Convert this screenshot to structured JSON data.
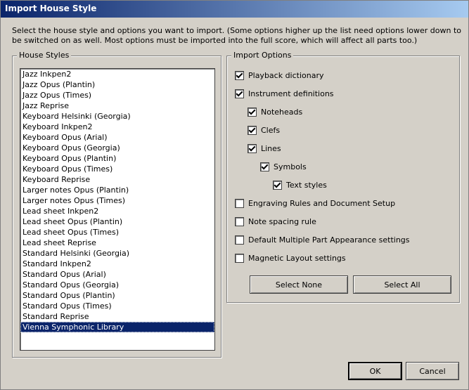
{
  "window": {
    "title": "Import House Style"
  },
  "description": "Select the house style and options you want to import. (Some options higher up the list need options lower down to be switched on as well. Most options must be imported into the full score, which will affect all parts too.)",
  "house_styles": {
    "legend": "House Styles",
    "items": [
      "Jazz Inkpen2",
      "Jazz Opus (Plantin)",
      "Jazz Opus (Times)",
      "Jazz Reprise",
      "Keyboard Helsinki (Georgia)",
      "Keyboard Inkpen2",
      "Keyboard Opus (Arial)",
      "Keyboard Opus (Georgia)",
      "Keyboard Opus (Plantin)",
      "Keyboard Opus (Times)",
      "Keyboard Reprise",
      "Larger notes Opus (Plantin)",
      "Larger notes Opus (Times)",
      "Lead sheet Inkpen2",
      "Lead sheet Opus (Plantin)",
      "Lead sheet Opus (Times)",
      "Lead sheet Reprise",
      "Standard Helsinki (Georgia)",
      "Standard Inkpen2",
      "Standard Opus (Arial)",
      "Standard Opus (Georgia)",
      "Standard Opus (Plantin)",
      "Standard Opus (Times)",
      "Standard Reprise",
      "Vienna Symphonic Library"
    ],
    "selected": "Vienna Symphonic Library"
  },
  "import_options": {
    "legend": "Import Options",
    "options": [
      {
        "label": "Playback dictionary",
        "checked": true
      },
      {
        "label": "Instrument definitions",
        "checked": true
      },
      {
        "label": "Noteheads",
        "checked": true
      },
      {
        "label": "Clefs",
        "checked": true
      },
      {
        "label": "Lines",
        "checked": true
      },
      {
        "label": "Symbols",
        "checked": true
      },
      {
        "label": "Text styles",
        "checked": true
      },
      {
        "label": "Engraving Rules and Document Setup",
        "checked": false
      },
      {
        "label": "Note spacing rule",
        "checked": false
      },
      {
        "label": "Default Multiple Part Appearance settings",
        "checked": false
      },
      {
        "label": "Magnetic Layout settings",
        "checked": false
      }
    ],
    "select_none_label": "Select None",
    "select_all_label": "Select All"
  },
  "buttons": {
    "ok_label": "OK",
    "cancel_label": "Cancel"
  }
}
